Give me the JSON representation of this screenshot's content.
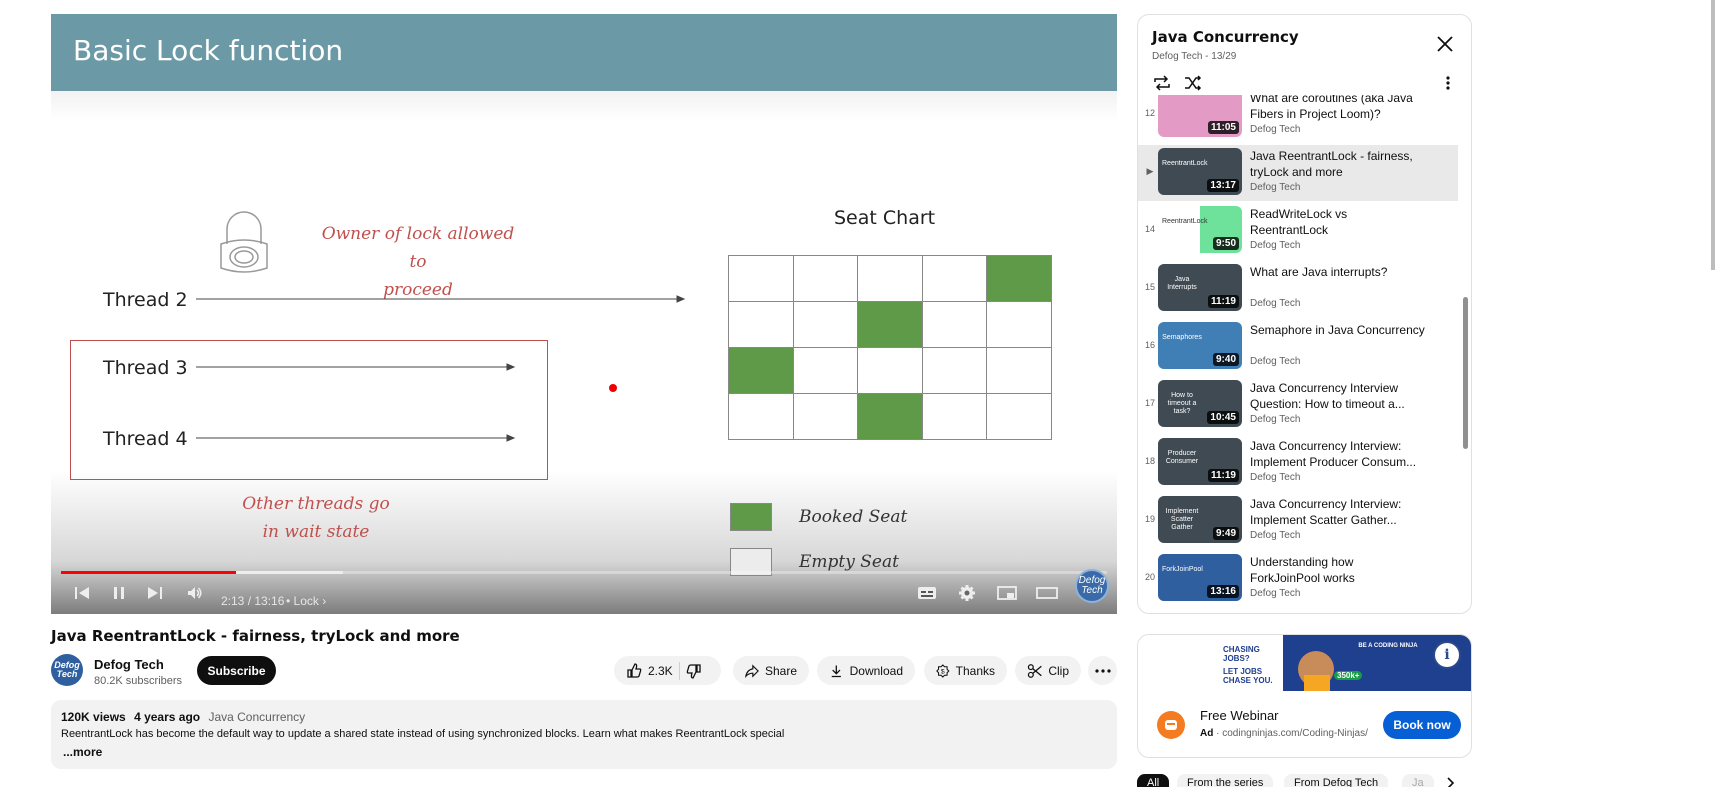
{
  "player": {
    "slide": {
      "title": "Basic Lock function",
      "seat_chart_title": "Seat Chart",
      "owner_note_line1": "Owner of lock allowed to",
      "owner_note_line2": "proceed",
      "threads": [
        "Thread 2",
        "Thread 3",
        "Thread 4"
      ],
      "wait_note_line1": "Other threads go",
      "wait_note_line2": "in wait state",
      "legend_booked": "Booked Seat",
      "legend_empty": "Empty Seat",
      "seat_grid": [
        [
          0,
          0,
          0,
          0,
          1
        ],
        [
          0,
          0,
          1,
          0,
          0
        ],
        [
          1,
          0,
          0,
          0,
          0
        ],
        [
          0,
          0,
          1,
          0,
          0
        ]
      ],
      "booked_color": "#5e9a48"
    },
    "progress_fraction": 0.167,
    "buffer_fraction": 0.27,
    "time": "2:13 / 13:16",
    "chapter": "• Lock",
    "watermark": "Defog Tech"
  },
  "video": {
    "title": "Java ReentrantLock - fairness, tryLock and more",
    "channel": "Defog Tech",
    "avatar_text": "Defog Tech",
    "subscribers": "80.2K subscribers",
    "subscribe_label": "Subscribe",
    "likes": "2.3K",
    "share_label": "Share",
    "download_label": "Download",
    "thanks_label": "Thanks",
    "clip_label": "Clip"
  },
  "description": {
    "views": "120K views",
    "age": "4 years ago",
    "series": "Java Concurrency",
    "text": "ReentrantLock has become the default way to update a shared state instead of using synchronized blocks. Learn what makes ReentrantLock special",
    "more": "...more"
  },
  "playlist": {
    "title": "Java Concurrency",
    "subtitle": "Defog Tech - 13/29",
    "items": [
      {
        "index": "12",
        "title": "What are coroutines (aka Java Fibers in Project Loom)?",
        "channel": "Defog Tech",
        "duration": "11:05",
        "thumb_text": "",
        "thumb_color": "#e39bc6"
      },
      {
        "index": "▶",
        "title": "Java ReentrantLock - fairness, tryLock and more",
        "channel": "Defog Tech",
        "duration": "13:17",
        "thumb_text": "ReentrantLock",
        "thumb_color": "#3f4a52"
      },
      {
        "index": "14",
        "title": "ReadWriteLock vs ReentrantLock",
        "channel": "Defog Tech",
        "duration": "9:50",
        "thumb_text": "ReentrantLock",
        "thumb_color": "#ffffff"
      },
      {
        "index": "15",
        "title": "What are Java interrupts?",
        "channel": "Defog Tech",
        "duration": "11:19",
        "thumb_text": "Java Interrupts",
        "thumb_color": "#3f4a52"
      },
      {
        "index": "16",
        "title": "Semaphore in Java Concurrency",
        "channel": "Defog Tech",
        "duration": "9:40",
        "thumb_text": "Semaphores",
        "thumb_color": "#3f7fb5"
      },
      {
        "index": "17",
        "title": "Java Concurrency Interview Question: How to timeout a...",
        "channel": "Defog Tech",
        "duration": "10:45",
        "thumb_text": "How to timeout a task?",
        "thumb_color": "#3f4a52"
      },
      {
        "index": "18",
        "title": "Java Concurrency Interview: Implement Producer Consum...",
        "channel": "Defog Tech",
        "duration": "11:19",
        "thumb_text": "Producer Consumer",
        "thumb_color": "#3f4a52"
      },
      {
        "index": "19",
        "title": "Java Concurrency Interview: Implement Scatter Gather...",
        "channel": "Defog Tech",
        "duration": "9:49",
        "thumb_text": "Implement Scatter Gather",
        "thumb_color": "#3f4a52"
      },
      {
        "index": "20",
        "title": "Understanding how ForkJoinPool works",
        "channel": "Defog Tech",
        "duration": "13:16",
        "thumb_text": "ForkJoinPool",
        "thumb_color": "#2f5f9e"
      }
    ]
  },
  "ad": {
    "banner_line1": "CHASING JOBS?",
    "banner_line2": "LET JOBS CHASE YOU.",
    "banner_right": "BE A CODING NINJA",
    "banner_badge": "350k+",
    "title": "Free Webinar",
    "ad_label": "Ad",
    "domain": "codingninjas.com/Coding-Ninjas/",
    "cta": "Book now"
  },
  "chips": [
    "All",
    "From the series",
    "From Defog Tech",
    "Ja"
  ]
}
